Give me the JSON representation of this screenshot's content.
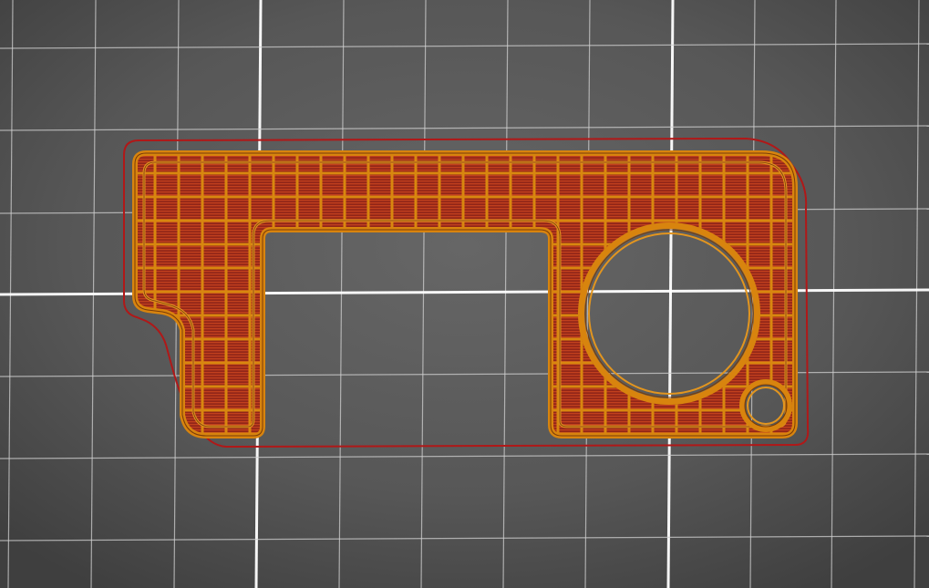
{
  "view": {
    "type": "3d-printer-slicer-layer-preview",
    "plate": {
      "background_color": "#5a5a5a",
      "vignette_color": "#3f3f3f",
      "grid_minor_color": "#cfcfcf",
      "grid_major_color": "#ffffff"
    },
    "part": {
      "skirt_color": "#b01818",
      "perimeter_color": "#d8840e",
      "perimeter_dark_color": "#7a3c08",
      "infill_color": "#9a2a1a",
      "infill_line_color": "#c2401e",
      "grid_infill_color": "#d8870f",
      "features": [
        "outer-skirt",
        "perimeter-walls",
        "grid-infill",
        "large-circular-hole",
        "small-keyring-hole",
        "rectangular-cutout"
      ]
    }
  }
}
